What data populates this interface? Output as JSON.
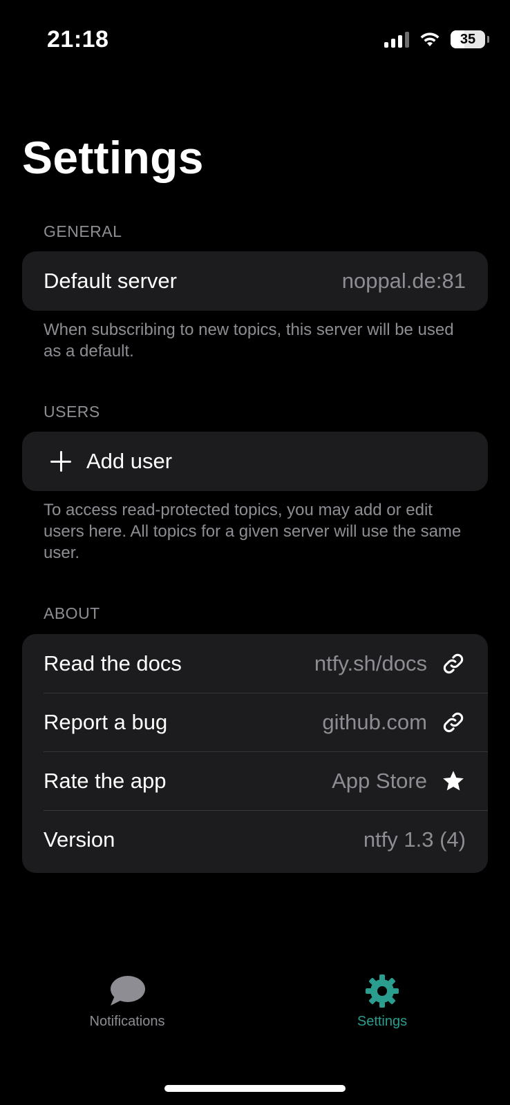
{
  "status_bar": {
    "time": "21:18",
    "battery": "35"
  },
  "page": {
    "title": "Settings"
  },
  "general": {
    "header": "GENERAL",
    "default_server_label": "Default server",
    "default_server_value": "noppal.de:81",
    "footer": "When subscribing to new topics, this server will be used as a default."
  },
  "users": {
    "header": "USERS",
    "add_user_label": "Add user",
    "footer": "To access read-protected topics, you may add or edit users here. All topics for a given server will use the same user."
  },
  "about": {
    "header": "ABOUT",
    "rows": [
      {
        "label": "Read the docs",
        "value": "ntfy.sh/docs",
        "icon": "link-icon"
      },
      {
        "label": "Report a bug",
        "value": "github.com",
        "icon": "link-icon"
      },
      {
        "label": "Rate the app",
        "value": "App Store",
        "icon": "star-icon"
      },
      {
        "label": "Version",
        "value": "ntfy 1.3 (4)"
      }
    ]
  },
  "tab_bar": {
    "tabs": [
      {
        "label": "Notifications",
        "icon": "chat-bubble-icon",
        "selected": false
      },
      {
        "label": "Settings",
        "icon": "gear-icon",
        "selected": true
      }
    ]
  },
  "colors": {
    "background": "#000000",
    "card": "#1c1c1e",
    "secondary_text": "#8d8d93",
    "accent": "#2a9d8f"
  }
}
